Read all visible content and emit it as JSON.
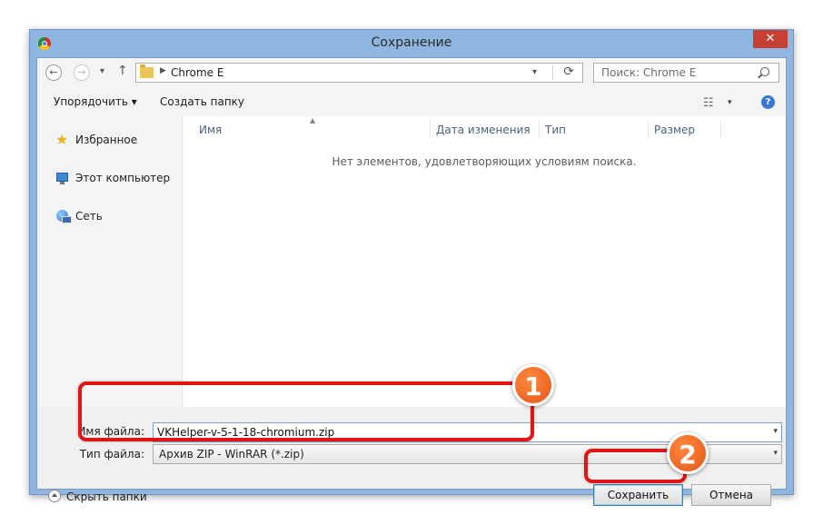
{
  "window": {
    "title": "Сохранение",
    "close_glyph": "✕"
  },
  "nav": {
    "back_glyph": "←",
    "forward_glyph": "→",
    "history_glyph": "▾",
    "up_glyph": "↑",
    "address_chevron": "▶",
    "address": "Chrome E",
    "address_dropdown_glyph": "▾",
    "refresh_glyph": "⟳",
    "search_placeholder": "Поиск: Chrome E"
  },
  "toolbar": {
    "organize_label": "Упорядочить ▾",
    "new_folder_label": "Создать папку",
    "views_glyph": "☷",
    "views_dropdown_glyph": "▾",
    "help_glyph": "?"
  },
  "sidebar": {
    "items": [
      {
        "label": "Избранное",
        "icon": "star-icon"
      },
      {
        "label": "Этот компьютер",
        "icon": "computer-icon"
      },
      {
        "label": "Сеть",
        "icon": "network-icon"
      }
    ]
  },
  "filelist": {
    "columns": [
      "Имя",
      "Дата изменения",
      "Тип",
      "Размер"
    ],
    "sort_glyph": "▲",
    "empty_message": "Нет элементов, удовлетворяющих условиям поиска."
  },
  "form": {
    "filename_label": "Имя файла:",
    "filename_value": "VKHelper-v-5-1-18-chromium.zip",
    "filetype_label": "Тип файла:",
    "filetype_value": "Архив ZIP - WinRAR (*.zip)",
    "dropdown_glyph": "▾"
  },
  "footer": {
    "hide_folders_label": "Скрыть папки",
    "save_label": "Сохранить",
    "cancel_label": "Отмена"
  },
  "annotations": {
    "badge_1": "1",
    "badge_2": "2",
    "highlight_color": "#e01515",
    "badge_color": "#e4551a"
  }
}
